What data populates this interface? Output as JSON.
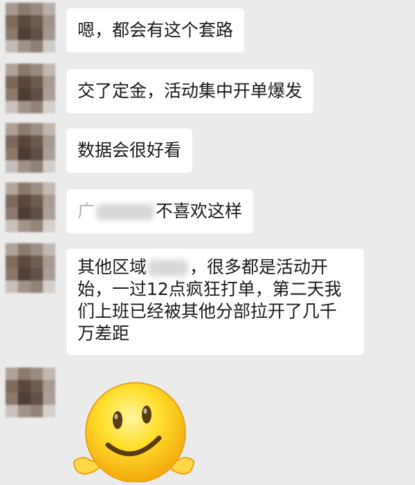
{
  "messages": [
    {
      "text": "嗯，都会有这个套路"
    },
    {
      "text": "交了定金，活动集中开单爆发"
    },
    {
      "text": "数据会很好看"
    },
    {
      "prefix": "广",
      "suffix": "不喜欢这样"
    },
    {
      "lines": [
        "其他区域",
        "，很多都是活动开",
        "始，一过12点疯狂打单，第二天我",
        "们上班已经被其他分部拉开了几千",
        "万差距"
      ]
    }
  ],
  "emoji": {
    "name": "smiley-emoji"
  },
  "colors": {
    "background": "#ebebeb",
    "bubble": "#ffffff",
    "text": "#1a1a1a",
    "emoji_face": "#ffd21f"
  }
}
